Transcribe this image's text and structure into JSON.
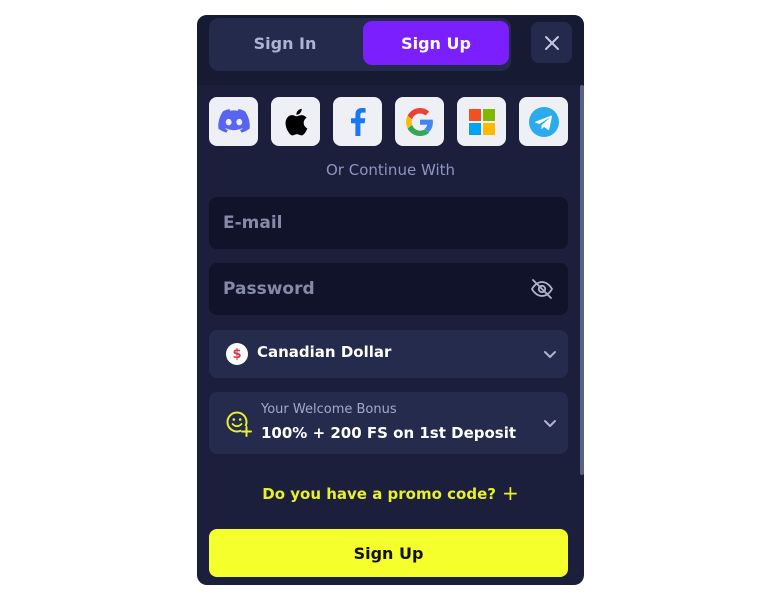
{
  "tabs": {
    "signin_label": "Sign In",
    "signup_label": "Sign Up",
    "active": "Sign Up"
  },
  "social_providers": [
    "discord",
    "apple",
    "facebook",
    "google",
    "microsoft",
    "telegram"
  ],
  "continue_text": "Or Continue With",
  "email": {
    "placeholder": "E-mail",
    "value": ""
  },
  "password": {
    "placeholder": "Password",
    "value": ""
  },
  "currency": {
    "symbol": "$",
    "label": "Canadian Dollar"
  },
  "bonus": {
    "caption": "Your Welcome Bonus",
    "value": "100% + 200 FS on 1st Deposit"
  },
  "promo": {
    "label": "Do you have a promo code?",
    "plus": "+"
  },
  "submit_label": "Sign Up",
  "colors": {
    "accent_purple": "#7b1fff",
    "accent_yellow": "#f4ff2c",
    "modal_bg": "#1b1f3b"
  }
}
